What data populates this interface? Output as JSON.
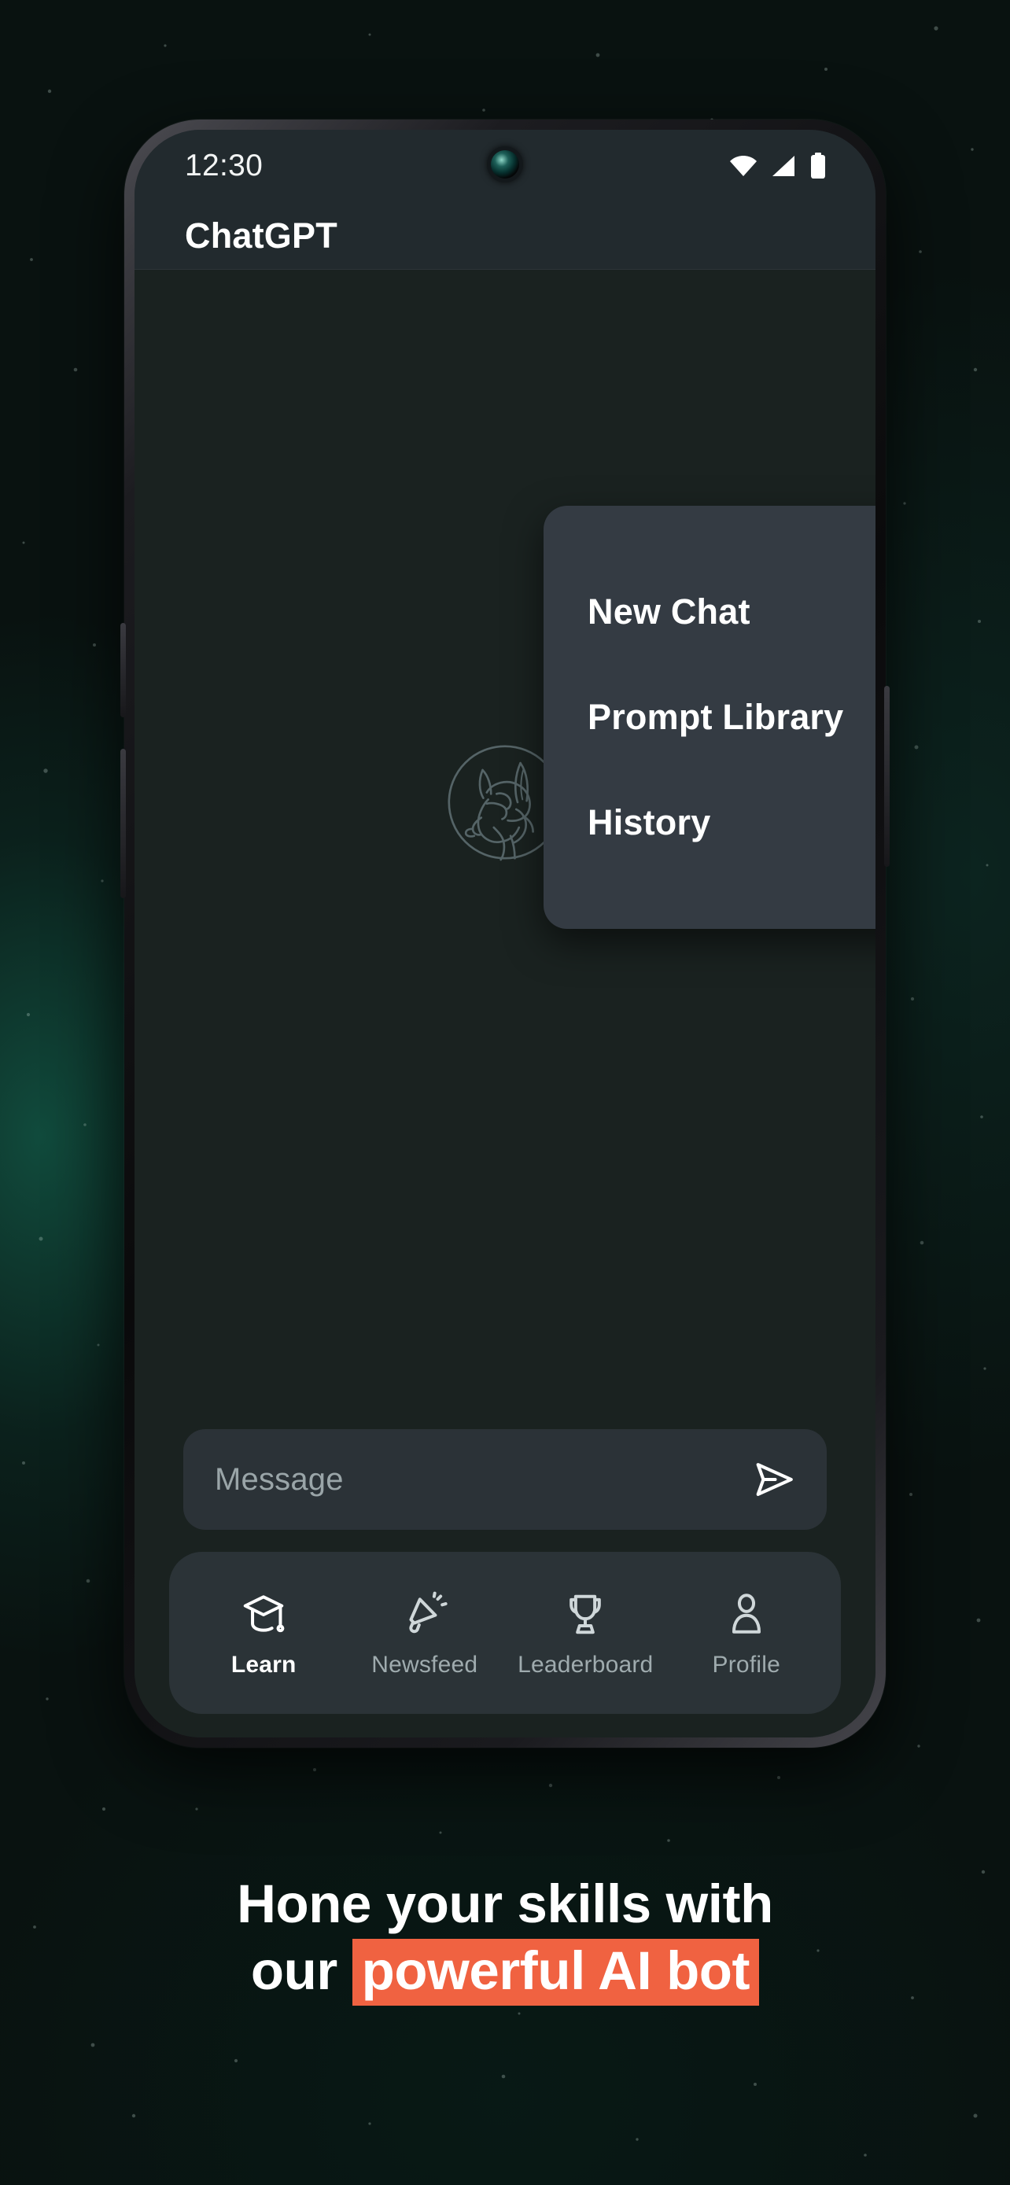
{
  "theme": {
    "background": "#0c1512",
    "accent": "#f06241",
    "screen_bg": "#1a2220",
    "appbar_bg": "#222a2e",
    "menu_bg": "#343b43",
    "nav_bg": "#2b3337",
    "input_bg": "#2b3237",
    "text_primary": "#ffffff",
    "text_muted": "#9fabae"
  },
  "statusbar": {
    "time": "12:30",
    "icons": [
      "wifi-icon",
      "cellular-signal-icon",
      "battery-icon"
    ]
  },
  "appbar": {
    "title": "ChatGPT"
  },
  "dropdown": {
    "items": [
      {
        "label": "New Chat",
        "icon": "plus-circle-icon"
      },
      {
        "label": "Prompt Library",
        "icon": "book-icon"
      },
      {
        "label": "History",
        "icon": "clock-icon"
      }
    ]
  },
  "chat": {
    "logo_alt": "llama-mascot-logo"
  },
  "composer": {
    "placeholder": "Message",
    "value": "",
    "send_icon": "send-arrow-icon"
  },
  "bottom_nav": {
    "items": [
      {
        "label": "Learn",
        "icon": "graduation-cap-icon",
        "active": true
      },
      {
        "label": "Newsfeed",
        "icon": "megaphone-icon",
        "active": false
      },
      {
        "label": "Leaderboard",
        "icon": "trophy-icon",
        "active": false
      },
      {
        "label": "Profile",
        "icon": "person-icon",
        "active": false
      }
    ]
  },
  "tagline": {
    "line1": "Hone your skills with",
    "line2_prefix": "our",
    "line2_highlight": "powerful AI bot"
  }
}
